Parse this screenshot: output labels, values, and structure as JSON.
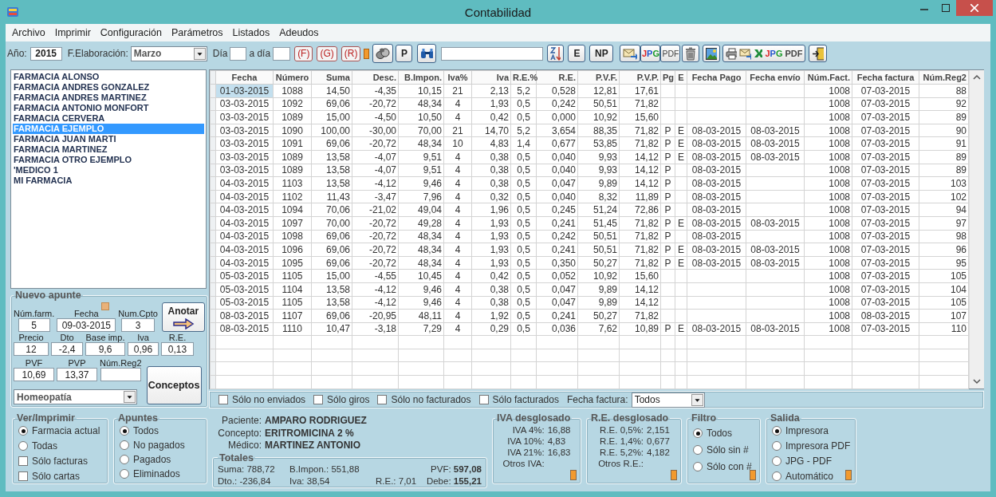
{
  "window": {
    "title": "Contabilidad"
  },
  "menu": [
    "Archivo",
    "Imprimir",
    "Configuración",
    "Parámetros",
    "Listados",
    "Adeudos"
  ],
  "toolbar": {
    "year_label": "Año:",
    "year": "2015",
    "month_label": "F.Elaboración:",
    "month": "Marzo",
    "day_label": "Día",
    "to_day_label": "a día",
    "report_buttons": [
      "(F)",
      "(G)",
      "(R)"
    ],
    "p_button": "P",
    "e_button": "E",
    "np_button": "NP",
    "jpg_button": "JPG",
    "pdf_button": "PDF",
    "export_jpg": "JPG",
    "export_pdf": "PDF"
  },
  "pharmacies": [
    {
      "name": "FARMACIA ALONSO",
      "selected": false
    },
    {
      "name": "FARMACIA ANDRES GONZALEZ",
      "selected": false
    },
    {
      "name": "FARMACIA ANDRES MARTINEZ",
      "selected": false
    },
    {
      "name": "FARMACIA ANTONIO MONFORT",
      "selected": false
    },
    {
      "name": "FARMACIA CERVERA",
      "selected": false
    },
    {
      "name": "FARMACIA EJEMPLO",
      "selected": true
    },
    {
      "name": "FARMACIA JUAN MARTI",
      "selected": false
    },
    {
      "name": "FARMACIA MARTINEZ",
      "selected": false
    },
    {
      "name": "FARMACIA OTRO EJEMPLO",
      "selected": false
    },
    {
      "name": "'MEDICO 1",
      "selected": false
    },
    {
      "name": "MI FARMACIA",
      "selected": false
    }
  ],
  "new_entry": {
    "title": "Nuevo apunte",
    "rows": [
      [
        {
          "label": "Núm.farm.",
          "value": "5"
        },
        {
          "label": "Fecha",
          "value": "09-03-2015"
        },
        {
          "label": "Num.Cpto",
          "value": "3"
        }
      ],
      [
        {
          "label": "Precio",
          "value": "12"
        },
        {
          "label": "Dto",
          "value": "-2,4"
        },
        {
          "label": "Base imp.",
          "value": "9,6"
        },
        {
          "label": "Iva",
          "value": "0,96"
        },
        {
          "label": "R.E.",
          "value": "0,13"
        }
      ],
      [
        {
          "label": "PVF",
          "value": "10,69"
        },
        {
          "label": "PVP",
          "value": "13,37"
        },
        {
          "label": "Núm.Reg2"
        }
      ]
    ],
    "annotate_button": "Anotar",
    "concepts_button": "Conceptos",
    "category": "Homeopatía"
  },
  "table": {
    "columns": [
      "Fecha",
      "Número",
      "Suma",
      "Desc.",
      "B.Impon.",
      "Iva%",
      "Iva",
      "R.E.%",
      "R.E.",
      "P.V.F.",
      "P.V.P.",
      "Pg",
      "E",
      "Fecha Pago",
      "Fecha envío",
      "Núm.Fact.",
      "Fecha factura",
      "Núm.Reg2"
    ],
    "rows": [
      {
        "selected": true,
        "cells": [
          "01-03-2015",
          "1088",
          "14,50",
          "-4,35",
          "10,15",
          "21",
          "2,13",
          "5,2",
          "0,528",
          "12,81",
          "17,61",
          null,
          null,
          null,
          null,
          "1008",
          "07-03-2015",
          "88"
        ]
      },
      {
        "selected": false,
        "cells": [
          "03-03-2015",
          "1092",
          "69,06",
          "-20,72",
          "48,34",
          "4",
          "1,93",
          "0,5",
          "0,242",
          "50,51",
          "71,82",
          null,
          null,
          null,
          null,
          "1008",
          "07-03-2015",
          "92"
        ]
      },
      {
        "selected": false,
        "cells": [
          "03-03-2015",
          "1089",
          "15,00",
          "-4,50",
          "10,50",
          "4",
          "0,42",
          "0,5",
          "0,000",
          "10,92",
          "15,60",
          null,
          null,
          null,
          null,
          "1008",
          "07-03-2015",
          "89"
        ]
      },
      {
        "selected": false,
        "cells": [
          "03-03-2015",
          "1090",
          "100,00",
          "-30,00",
          "70,00",
          "21",
          "14,70",
          "5,2",
          "3,654",
          "88,35",
          "71,82",
          "P",
          "E",
          "08-03-2015",
          "08-03-2015",
          "1008",
          "07-03-2015",
          "90"
        ]
      },
      {
        "selected": false,
        "cells": [
          "03-03-2015",
          "1091",
          "69,06",
          "-20,72",
          "48,34",
          "10",
          "4,83",
          "1,4",
          "0,677",
          "53,85",
          "71,82",
          "P",
          "E",
          "08-03-2015",
          "08-03-2015",
          "1008",
          "07-03-2015",
          "91"
        ]
      },
      {
        "selected": false,
        "cells": [
          "03-03-2015",
          "1089",
          "13,58",
          "-4,07",
          "9,51",
          "4",
          "0,38",
          "0,5",
          "0,040",
          "9,93",
          "14,12",
          "P",
          "E",
          "08-03-2015",
          "08-03-2015",
          "1008",
          "07-03-2015",
          "89"
        ]
      },
      {
        "selected": false,
        "cells": [
          "03-03-2015",
          "1089",
          "13,58",
          "-4,07",
          "9,51",
          "4",
          "0,38",
          "0,5",
          "0,040",
          "9,93",
          "14,12",
          "P",
          null,
          "08-03-2015",
          null,
          "1008",
          "07-03-2015",
          "89"
        ]
      },
      {
        "selected": false,
        "cells": [
          "04-03-2015",
          "1103",
          "13,58",
          "-4,12",
          "9,46",
          "4",
          "0,38",
          "0,5",
          "0,047",
          "9,89",
          "14,12",
          "P",
          null,
          "08-03-2015",
          null,
          "1008",
          "07-03-2015",
          "103"
        ]
      },
      {
        "selected": false,
        "cells": [
          "04-03-2015",
          "1102",
          "11,43",
          "-3,47",
          "7,96",
          "4",
          "0,32",
          "0,5",
          "0,040",
          "8,32",
          "11,89",
          "P",
          null,
          "08-03-2015",
          null,
          "1008",
          "07-03-2015",
          "102"
        ]
      },
      {
        "selected": false,
        "cells": [
          "04-03-2015",
          "1094",
          "70,06",
          "-21,02",
          "49,04",
          "4",
          "1,96",
          "0,5",
          "0,245",
          "51,24",
          "72,86",
          "P",
          null,
          "08-03-2015",
          null,
          "1008",
          "07-03-2015",
          "94"
        ]
      },
      {
        "selected": false,
        "cells": [
          "04-03-2015",
          "1097",
          "70,00",
          "-20,72",
          "49,28",
          "4",
          "1,93",
          "0,5",
          "0,241",
          "51,45",
          "71,82",
          "P",
          "E",
          "08-03-2015",
          "08-03-2015",
          "1008",
          "07-03-2015",
          "97"
        ]
      },
      {
        "selected": false,
        "cells": [
          "04-03-2015",
          "1098",
          "69,06",
          "-20,72",
          "48,34",
          "4",
          "1,93",
          "0,5",
          "0,242",
          "50,51",
          "71,82",
          "P",
          null,
          "08-03-2015",
          null,
          "1008",
          "07-03-2015",
          "98"
        ]
      },
      {
        "selected": false,
        "cells": [
          "04-03-2015",
          "1096",
          "69,06",
          "-20,72",
          "48,34",
          "4",
          "1,93",
          "0,5",
          "0,241",
          "50,51",
          "71,82",
          "P",
          "E",
          "08-03-2015",
          "08-03-2015",
          "1008",
          "07-03-2015",
          "96"
        ]
      },
      {
        "selected": false,
        "cells": [
          "04-03-2015",
          "1095",
          "69,06",
          "-20,72",
          "48,34",
          "4",
          "1,93",
          "0,5",
          "0,350",
          "50,27",
          "71,82",
          "P",
          "E",
          "08-03-2015",
          "08-03-2015",
          "1008",
          "07-03-2015",
          "95"
        ]
      },
      {
        "selected": false,
        "cells": [
          "05-03-2015",
          "1105",
          "15,00",
          "-4,55",
          "10,45",
          "4",
          "0,42",
          "0,5",
          "0,052",
          "10,92",
          "15,60",
          null,
          null,
          null,
          null,
          "1008",
          "07-03-2015",
          "105"
        ]
      },
      {
        "selected": false,
        "cells": [
          "05-03-2015",
          "1104",
          "13,58",
          "-4,12",
          "9,46",
          "4",
          "0,38",
          "0,5",
          "0,047",
          "9,89",
          "14,12",
          null,
          null,
          null,
          null,
          "1008",
          "07-03-2015",
          "104"
        ]
      },
      {
        "selected": false,
        "cells": [
          "05-03-2015",
          "1105",
          "13,58",
          "-4,12",
          "9,46",
          "4",
          "0,38",
          "0,5",
          "0,047",
          "9,89",
          "14,12",
          null,
          null,
          null,
          null,
          "1008",
          "07-03-2015",
          "105"
        ]
      },
      {
        "selected": false,
        "cells": [
          "08-03-2015",
          "1107",
          "69,06",
          "-20,95",
          "48,11",
          "4",
          "1,92",
          "0,5",
          "0,241",
          "50,27",
          "71,82",
          null,
          null,
          null,
          null,
          "1008",
          "08-03-2015",
          "107"
        ]
      },
      {
        "selected": false,
        "cells": [
          "08-03-2015",
          "1110",
          "10,47",
          "-3,18",
          "7,29",
          "4",
          "0,29",
          "0,5",
          "0,036",
          "7,62",
          "10,89",
          "P",
          "E",
          "08-03-2015",
          "08-03-2015",
          "1008",
          "07-03-2015",
          "110"
        ]
      }
    ]
  },
  "filters": {
    "checkboxes": [
      {
        "label": "Sólo no enviados",
        "checked": false
      },
      {
        "label": "Sólo giros",
        "checked": false
      },
      {
        "label": "Sólo no facturados",
        "checked": false
      },
      {
        "label": "Sólo facturados",
        "checked": false
      }
    ],
    "invoice_date_label": "Fecha factura:",
    "invoice_date": "Todos"
  },
  "view_print": {
    "title": "Ver/Imprimir",
    "radios": [
      {
        "label": "Farmacia actual",
        "selected": true
      },
      {
        "label": "Todas",
        "selected": false
      }
    ],
    "checkboxes": [
      {
        "label": "Sólo facturas",
        "checked": false
      },
      {
        "label": "Sólo cartas",
        "checked": false
      }
    ]
  },
  "entries": {
    "title": "Apuntes",
    "radios": [
      {
        "label": "Todos",
        "selected": true
      },
      {
        "label": "No pagados",
        "selected": false
      },
      {
        "label": "Pagados",
        "selected": false
      },
      {
        "label": "Eliminados",
        "selected": false
      }
    ]
  },
  "details": [
    {
      "label": "Paciente:",
      "value": "AMPARO RODRIGUEZ"
    },
    {
      "label": "Concepto:",
      "value": "ERITROMICINA 2 %"
    },
    {
      "label": "Médico:",
      "value": "MARTINEZ ANTONIO"
    }
  ],
  "totals": {
    "title": "Totales",
    "rows": [
      [
        "Suma: 788,72",
        "B.Impon.: 551,88",
        "",
        "PVF: **597,08**"
      ],
      [
        "Dto.: -236,84",
        "Iva: 38,54",
        "R.E.: 7,01",
        "Debe: **155,21**"
      ]
    ]
  },
  "iva_breakdown": {
    "title": "IVA desglosado",
    "items": [
      {
        "label": "IVA 4%:",
        "value": "16,88"
      },
      {
        "label": "IVA 10%:",
        "value": "4,83"
      },
      {
        "label": "IVA 21%:",
        "value": "16,83"
      },
      {
        "label": "Otros IVA:"
      }
    ]
  },
  "re_breakdown": {
    "title": "R.E. desglosado",
    "items": [
      {
        "label": "R.E. 0,5%:",
        "value": "2,151"
      },
      {
        "label": "R.E. 1,4%:",
        "value": "0,677"
      },
      {
        "label": "R.E. 5,2%:",
        "value": "4,182"
      },
      {
        "label": "Otros R.E.:"
      }
    ]
  },
  "filter": {
    "title": "Filtro",
    "radios": [
      {
        "label": "Todos",
        "selected": true
      },
      {
        "label": "Sólo sin #",
        "selected": false
      },
      {
        "label": "Sólo con #",
        "selected": false
      }
    ]
  },
  "output": {
    "title": "Salida",
    "radios": [
      {
        "label": "Impresora",
        "selected": true
      },
      {
        "label": "Impresora PDF",
        "selected": false
      },
      {
        "label": "JPG - PDF",
        "selected": false
      },
      {
        "label": "Automático",
        "selected": false
      }
    ]
  }
}
